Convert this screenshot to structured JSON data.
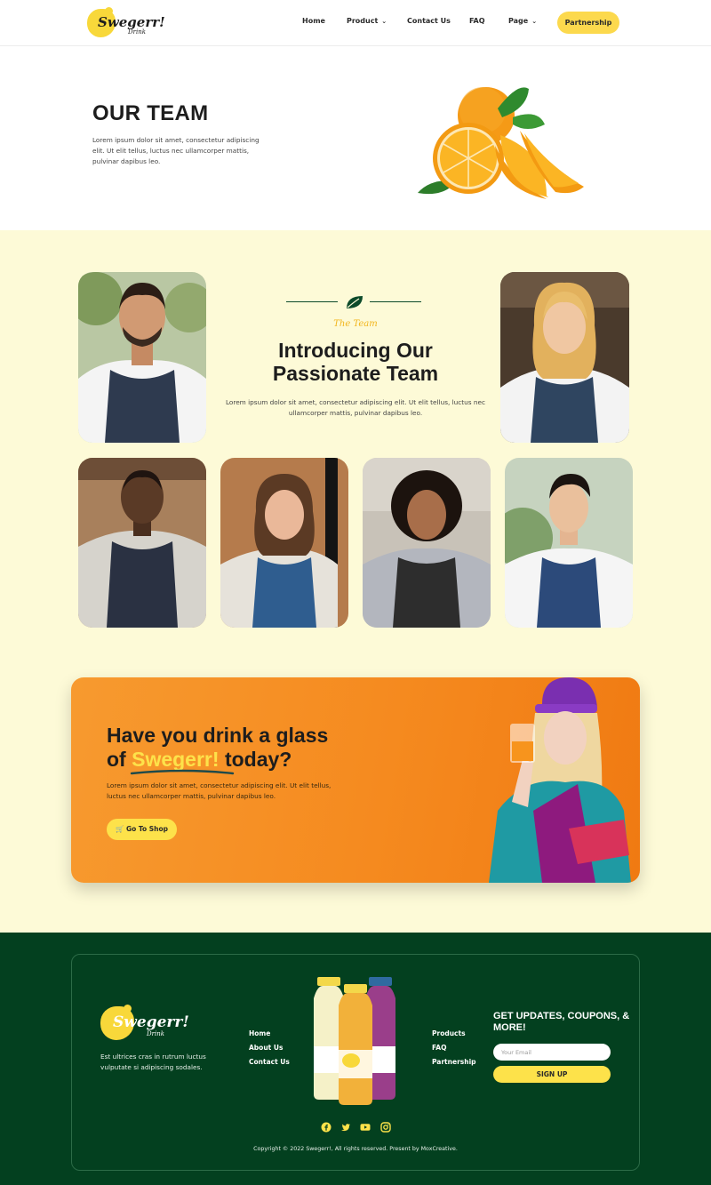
{
  "brand": {
    "name": "Swegerr!",
    "tagline": "Drink",
    "accent_yellow": "#fcd94d",
    "accent_orange": "#f58a1f",
    "dark_green": "#03401f",
    "cream": "#fdfad7"
  },
  "header": {
    "nav": [
      {
        "label": "Home"
      },
      {
        "label": "Product",
        "has_dropdown": true
      },
      {
        "label": "Contact Us"
      },
      {
        "label": "FAQ"
      },
      {
        "label": "Page",
        "has_dropdown": true
      }
    ],
    "cta_label": "Partnership"
  },
  "hero": {
    "title": "OUR TEAM",
    "text": "Lorem ipsum dolor sit amet, consectetur adipiscing elit. Ut elit tellus, luctus nec ullamcorper mattis, pulvinar dapibus leo."
  },
  "team": {
    "kicker": "The Team",
    "title": "Introducing Our Passionate Team",
    "text": "Lorem ipsum dolor sit amet, consectetur adipiscing elit. Ut elit tellus, luctus nec ullamcorper mattis, pulvinar dapibus leo."
  },
  "cta": {
    "title_line1": "Have you drink a glass",
    "title_of": "of",
    "title_brand": "Swegerr!",
    "title_end": "today?",
    "text": "Lorem ipsum dolor sit amet, consectetur adipiscing elit. Ut elit tellus, luctus nec ullamcorper mattis, pulvinar dapibus leo.",
    "button_label": "Go To Shop"
  },
  "footer": {
    "brand_name": "Swegerr!",
    "brand_tagline": "Drink",
    "text": "Est ultrices cras in rutrum luctus vulputate si adipiscing sodales.",
    "links_left": [
      "Home",
      "About Us",
      "Contact Us"
    ],
    "links_right": [
      "Products",
      "FAQ",
      "Partnership"
    ],
    "newsletter_title": "GET UPDATES, COUPONS, & MORE!",
    "email_placeholder": "Your Email",
    "signup_label": "SIGN UP",
    "social_icons": [
      "facebook-icon",
      "twitter-icon",
      "youtube-icon",
      "instagram-icon"
    ],
    "copyright": "Copyright © 2022 Swegerr!, All rights reserved. Present by MoxCreative."
  }
}
